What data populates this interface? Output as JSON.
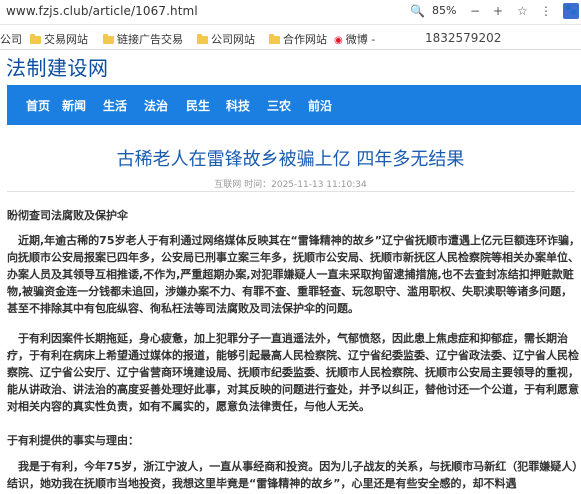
{
  "browser": {
    "url": "www.fzjs.club/article/1067.html",
    "zoom": "85%",
    "ext_label": "🐾"
  },
  "bookmarks": {
    "items": [
      {
        "label": "公司"
      },
      {
        "label": "交易网站"
      },
      {
        "label": "链接广告交易"
      },
      {
        "label": "公司网站"
      },
      {
        "label": "合作网站"
      },
      {
        "label": "微博 -"
      }
    ],
    "phone": "1832579202"
  },
  "site": {
    "title": "法制建设网",
    "nav": [
      "首页",
      "新闻",
      "生活",
      "法治",
      "民生",
      "科技",
      "三农",
      "前沿"
    ]
  },
  "article": {
    "title": "古稀老人在雷锋故乡被骗上亿 四年多无结果",
    "meta": "互联网 时间：2025-11-13 11:10:34",
    "paragraphs": [
      "盼彻查司法腐败及保护伞",
      "近期,年逾古稀的75岁老人于有利通过网络媒体反映其在“雷锋精神的故乡”辽宁省抚顺市遭遇上亿元巨额连环诈骗，向抚顺市公安局报案已四年多，公安局已刑事立案三年多，抚顺市公安局、抚顺市新抚区人民检察院等相关办案单位、办案人员及其领导互相推诿,不作为,严重超期办案,对犯罪嫌疑人一直未采取拘留逮捕措施,也不去查封冻结扣押赃款赃物,被骗资金连一分钱都未追回，涉嫌办案不力、有罪不查、重罪轻查、玩忽职守、滥用职权、失职渎职等诸多问题，甚至不排除其中有包庇纵容、徇私枉法等司法腐败及司法保护伞的问题。",
      "于有利因案件长期拖延，身心疲惫，加上犯罪分子一直逍遥法外，气郁愤怒，因此患上焦虑症和抑郁症，需长期治疗，于有利在病床上希望通过媒体的报道，能够引起最高人民检察院、辽宁省纪委监委、辽宁省政法委、辽宁省人民检察院、辽宁省公安厅、辽宁省营商环境建设局、抚顺市纪委监委、抚顺市人民检察院、抚顺市公安局主要领导的重视，能从讲政治、讲法治的高度妥善处理好此事，对其反映的问题进行查处，并予以纠正，替他讨还一个公道，于有利愿意对相关内容的真实性负责，如有不属实的，愿意负法律责任，与他人无关。",
      "于有利提供的事实与理由：",
      "我是于有利，今年75岁，浙江宁波人，一直从事经商和投资。因为儿子战友的关系，与抚顺市马新红（犯罪嫌疑人）结识，她劝我在抚顺市当地投资，我想这里毕竟是“雷锋精神的故乡”，心里还是有些安全感的，却不料遇"
    ]
  }
}
